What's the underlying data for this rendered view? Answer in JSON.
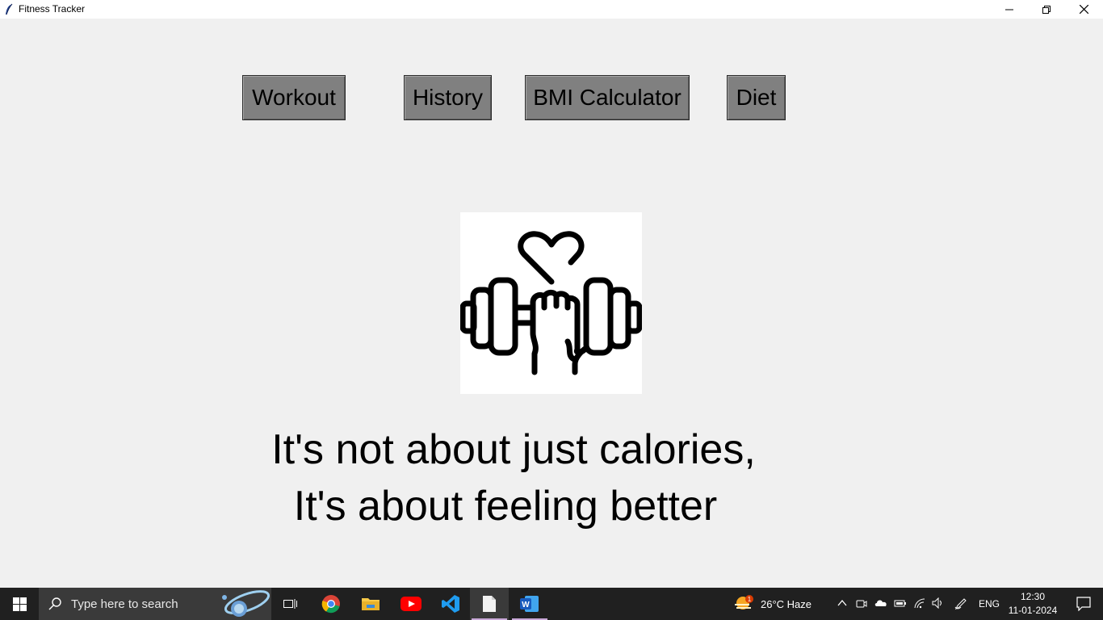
{
  "window": {
    "title": "Fitness Tracker"
  },
  "nav": {
    "workout": "Workout",
    "history": "History",
    "bmi": "BMI Calculator",
    "diet": "Diet"
  },
  "hero": {
    "icon": "dumbbell-heart-icon"
  },
  "quote": {
    "line1": "It's not about just calories,",
    "line2": "It's about feeling better"
  },
  "taskbar": {
    "search_placeholder": "Type here to search",
    "apps": [
      "chrome",
      "file-explorer",
      "youtube",
      "vscode",
      "notepad",
      "word"
    ],
    "weather_badge": "1",
    "weather": "26°C  Haze",
    "language": "ENG",
    "time": "12:30",
    "date": "11-01-2024"
  },
  "colors": {
    "button_bg": "#808080",
    "window_bg": "#f0f0f0",
    "taskbar_bg": "#202020"
  }
}
